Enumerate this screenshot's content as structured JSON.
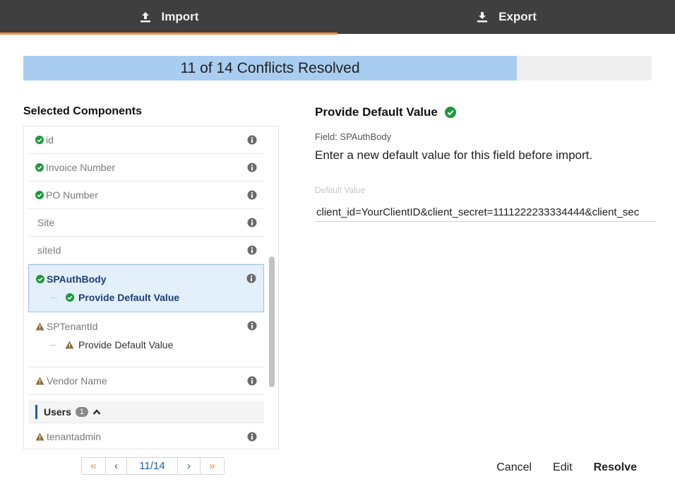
{
  "tabs": [
    {
      "label": "Import",
      "icon": "upload-icon",
      "active": true
    },
    {
      "label": "Export",
      "icon": "download-icon",
      "active": false
    }
  ],
  "progress": {
    "text": "11 of 14 Conflicts Resolved",
    "resolved": 11,
    "total": 14
  },
  "left": {
    "title": "Selected Components",
    "items": [
      {
        "label": "id",
        "status": "resolved"
      },
      {
        "label": "Invoice Number",
        "status": "resolved"
      },
      {
        "label": "PO Number",
        "status": "resolved"
      },
      {
        "label": "Site",
        "status": "none"
      },
      {
        "label": "siteId",
        "status": "none"
      },
      {
        "label": "SPAuthBody",
        "status": "resolved",
        "sub": "Provide Default Value"
      },
      {
        "label": "SPTenantId",
        "status": "warning",
        "sub": "Provide Default Value"
      },
      {
        "label": "Vendor Name",
        "status": "warning"
      }
    ],
    "group": {
      "label": "Users",
      "count": "1"
    },
    "group_items": [
      {
        "label": "tenantadmin",
        "status": "warning"
      }
    ]
  },
  "pager": {
    "first": "«",
    "prev": "‹",
    "page": "11/14",
    "next": "›",
    "last": "»"
  },
  "right": {
    "title": "Provide Default Value",
    "field": "Field: SPAuthBody",
    "description": "Enter a new default value for this field before import.",
    "default_label": "Default Value",
    "default_value": "client_id=YourClientID&client_secret=1111222233334444&client_sec"
  },
  "actions": {
    "cancel": "Cancel",
    "edit": "Edit",
    "resolve": "Resolve"
  },
  "colors": {
    "accent": "#f08a3c",
    "check": "#1a9a3a",
    "warning": "#8a6d3b",
    "selected_bg": "#e4effc",
    "progress_fill": "#a9cdf0",
    "link": "#1f5ea8"
  }
}
